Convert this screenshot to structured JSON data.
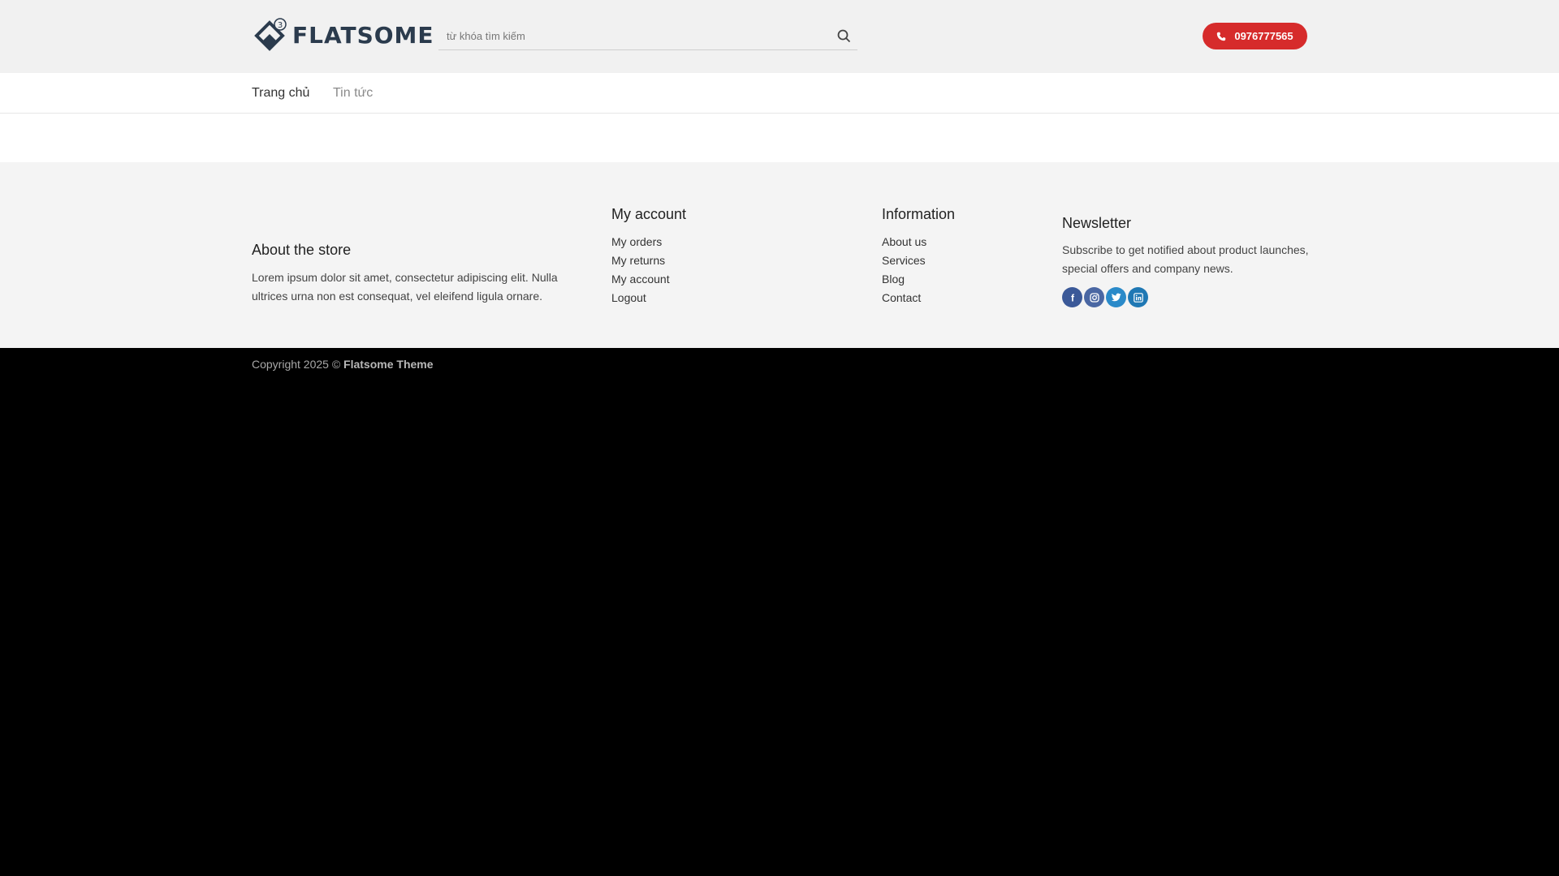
{
  "header": {
    "logo_text": "FLATSOME",
    "logo_badge": "3",
    "search_placeholder": "từ khóa tìm kiếm",
    "phone": "0976777565"
  },
  "nav": {
    "items": [
      {
        "label": "Trang chủ"
      },
      {
        "label": "Tin tức"
      }
    ]
  },
  "footer": {
    "about": {
      "title": "About the store",
      "text": "Lorem ipsum dolor sit amet, consectetur adipiscing elit. Nulla ultrices urna non est consequat, vel eleifend ligula ornare."
    },
    "account": {
      "title": "My account",
      "links": [
        "My orders",
        "My returns",
        "My account",
        "Logout"
      ]
    },
    "information": {
      "title": "Information",
      "links": [
        "About us",
        "Services",
        "Blog",
        "Contact"
      ]
    },
    "newsletter": {
      "title": "Newsletter",
      "text": "Subscribe to get notified about product launches, special offers and company news.",
      "socials": [
        "facebook-icon",
        "instagram-icon",
        "twitter-icon",
        "linkedin-icon"
      ]
    }
  },
  "copyright": {
    "prefix": "Copyright 2025 ©",
    "brand": "Flatsome Theme"
  },
  "colors": {
    "phone_button": "#d62b2b",
    "logo": "#2b3b4d",
    "header_bg": "#f1f1f1",
    "footer_bg": "#f4f4f4",
    "bottom_bg": "#000000"
  }
}
